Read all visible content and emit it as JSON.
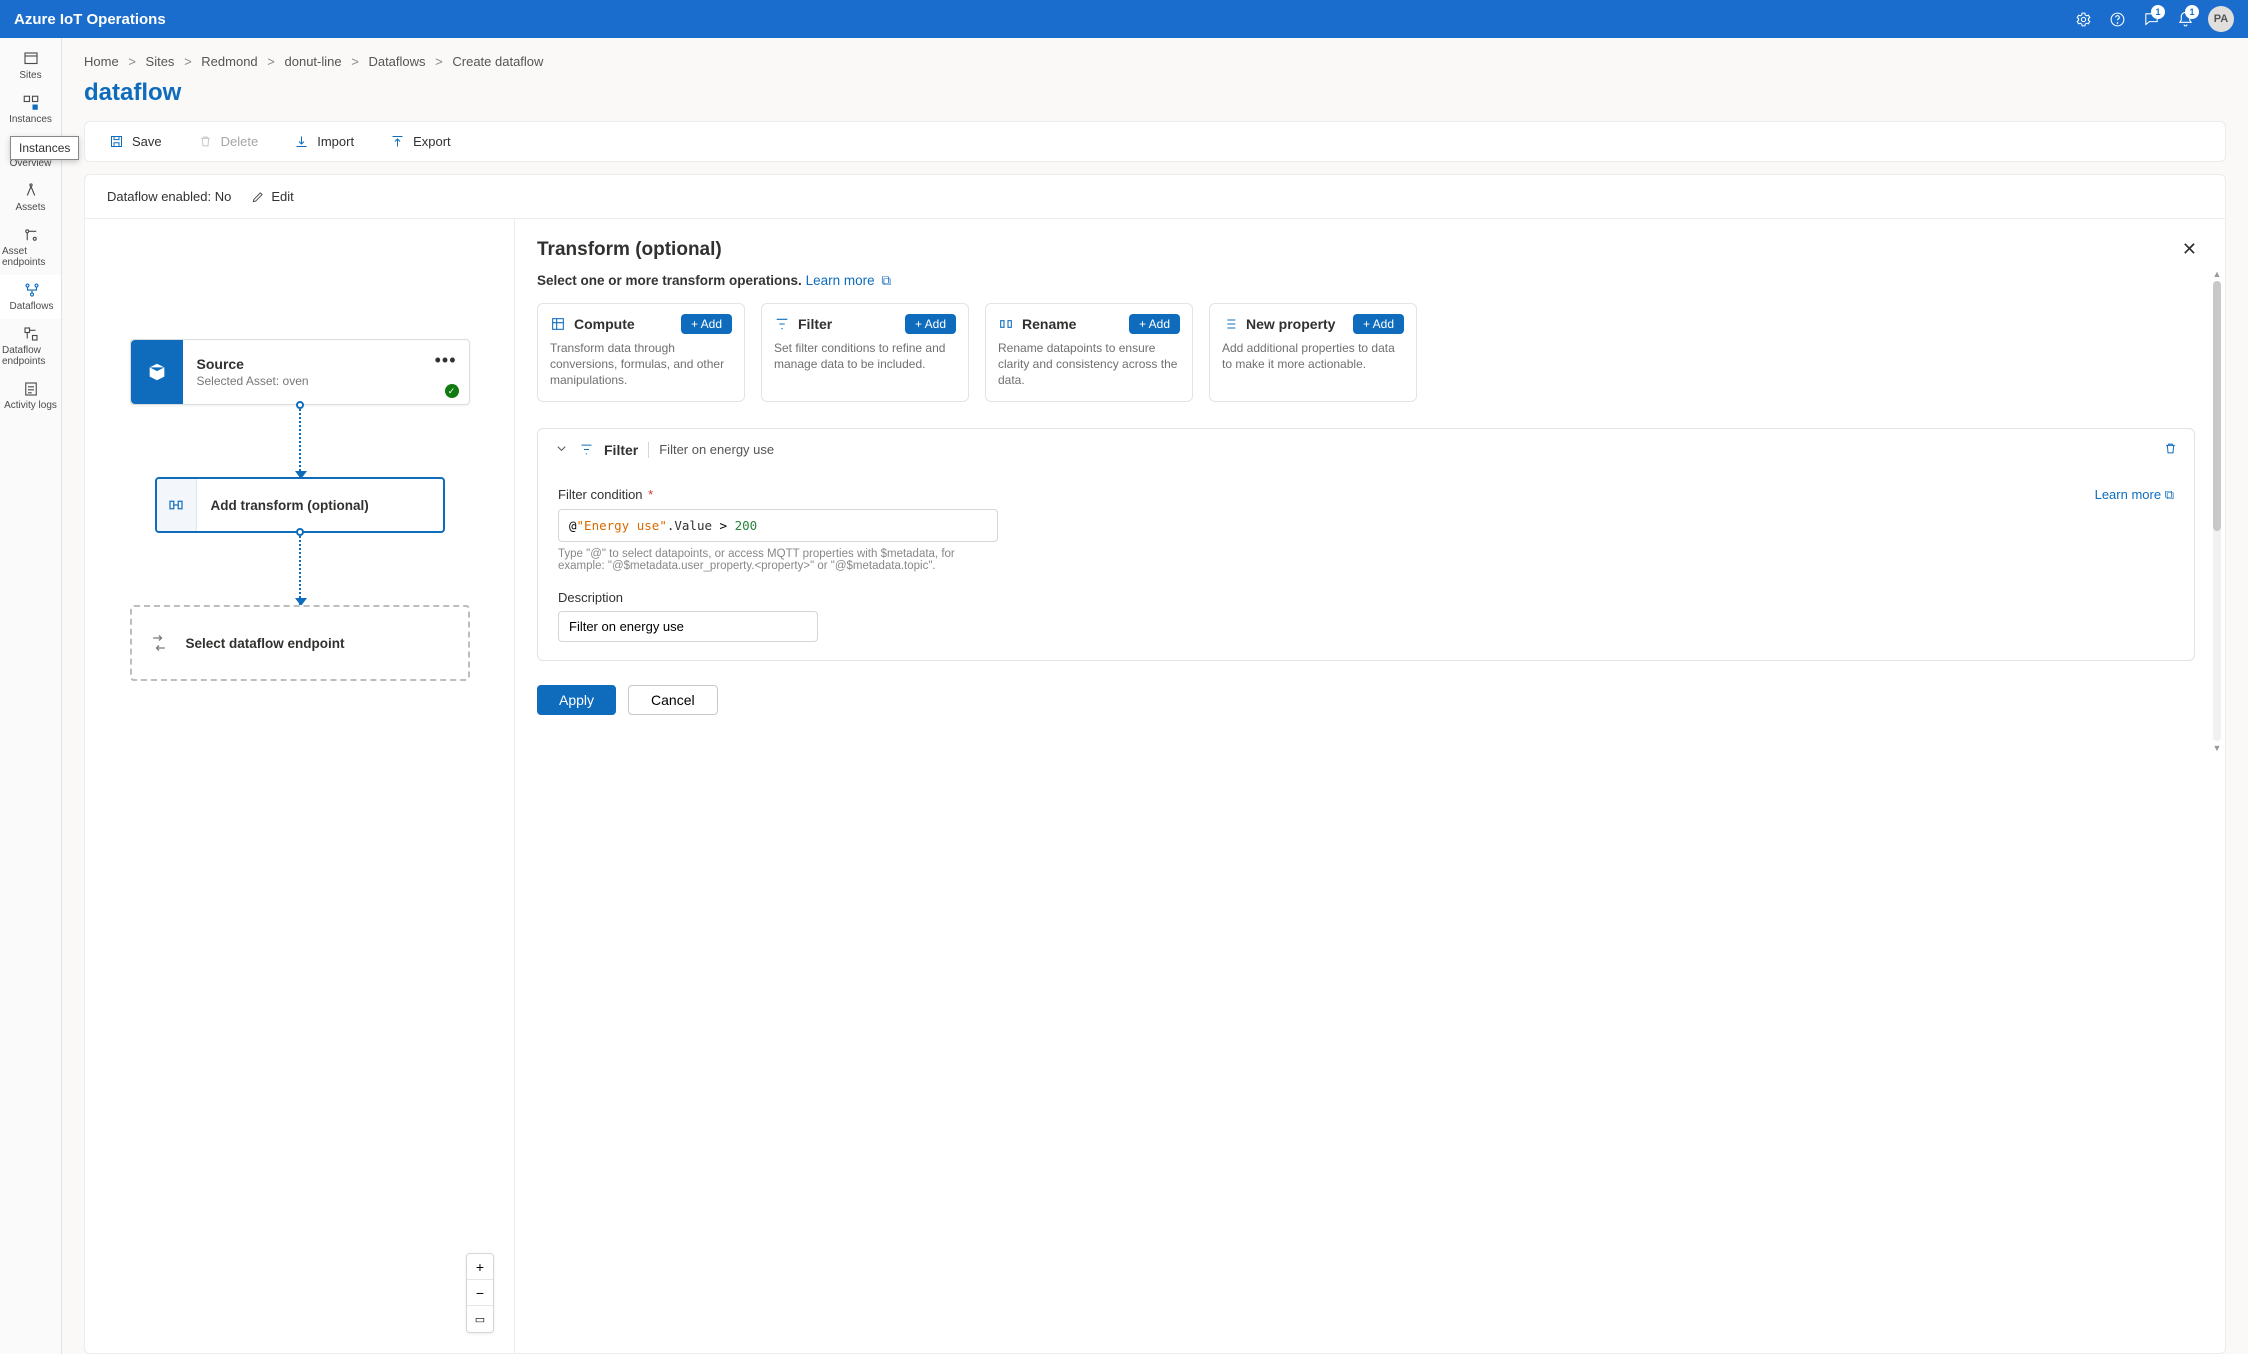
{
  "topbar": {
    "brand": "Azure IoT Operations",
    "feedback_badge": "1",
    "notifications_badge": "1",
    "avatar_initials": "PA"
  },
  "sidenav": {
    "items": [
      {
        "id": "sites",
        "label": "Sites"
      },
      {
        "id": "instances",
        "label": "Instances"
      },
      {
        "id": "overview",
        "label": "Overview"
      },
      {
        "id": "assets",
        "label": "Assets"
      },
      {
        "id": "asset-endpoints",
        "label": "Asset endpoints"
      },
      {
        "id": "dataflows",
        "label": "Dataflows"
      },
      {
        "id": "dataflow-endpoints",
        "label": "Dataflow endpoints"
      },
      {
        "id": "activity-logs",
        "label": "Activity logs"
      }
    ],
    "tooltip": "Instances"
  },
  "breadcrumb": {
    "items": [
      {
        "label": "Home"
      },
      {
        "label": "Sites"
      },
      {
        "label": "Redmond"
      },
      {
        "label": "donut-line"
      },
      {
        "label": "Dataflows"
      },
      {
        "label": "Create dataflow",
        "current": true
      }
    ]
  },
  "page_title": "dataflow",
  "toolbar": {
    "save": "Save",
    "delete": "Delete",
    "import": "Import",
    "export": "Export"
  },
  "status": {
    "enabled_label": "Dataflow enabled:",
    "enabled_value": "No",
    "edit": "Edit"
  },
  "canvas": {
    "source_title": "Source",
    "source_sub": "Selected Asset: oven",
    "transform_label": "Add transform (optional)",
    "endpoint_label": "Select dataflow endpoint"
  },
  "panel": {
    "heading": "Transform (optional)",
    "subheading": "Select one or more transform operations.",
    "learn_more": "Learn more",
    "ops": [
      {
        "id": "compute",
        "title": "Compute",
        "desc": "Transform data through conversions, formulas, and other manipulations.",
        "add": "Add"
      },
      {
        "id": "filter",
        "title": "Filter",
        "desc": "Set filter conditions to refine and manage data to be included.",
        "add": "Add"
      },
      {
        "id": "rename",
        "title": "Rename",
        "desc": "Rename datapoints to ensure clarity and consistency across the data.",
        "add": "Add"
      },
      {
        "id": "newprop",
        "title": "New property",
        "desc": "Add additional properties to data to make it more actionable.",
        "add": "Add"
      }
    ],
    "applied": {
      "name": "Filter",
      "desc": "Filter on energy use",
      "cond_label": "Filter condition",
      "cond_at": "@",
      "cond_str": "\"Energy use\"",
      "cond_prop": ".Value",
      "cond_op": " > ",
      "cond_num": "200",
      "cond_hint": "Type \"@\" to select datapoints, or access MQTT properties with $metadata, for example: \"@$metadata.user_property.<property>\" or \"@$metadata.topic\".",
      "learn_more": "Learn more",
      "desc_label": "Description",
      "desc_value": "Filter on energy use"
    },
    "apply": "Apply",
    "cancel": "Cancel"
  }
}
